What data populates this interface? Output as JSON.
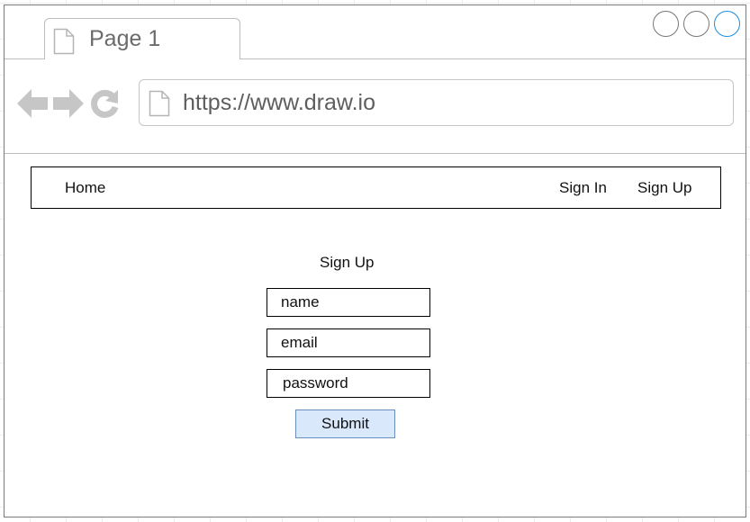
{
  "browser": {
    "tab_title": "Page 1",
    "url": "https://www.draw.io",
    "icons": {
      "tab": "page-icon",
      "back": "back-arrow-icon",
      "forward": "forward-arrow-icon",
      "reload": "reload-icon",
      "address": "page-icon"
    },
    "window_controls": [
      "window-circle",
      "window-circle",
      "window-circle-accent"
    ],
    "accent_color": "#1c8fe0"
  },
  "navbar": {
    "home": "Home",
    "sign_in": "Sign In",
    "sign_up": "Sign Up"
  },
  "form": {
    "title": "Sign Up",
    "name_placeholder": "name",
    "email_placeholder": "email",
    "password_placeholder": "password",
    "submit_label": "Submit",
    "submit_fill": "#dae8fc",
    "submit_border": "#6c8ebf"
  }
}
